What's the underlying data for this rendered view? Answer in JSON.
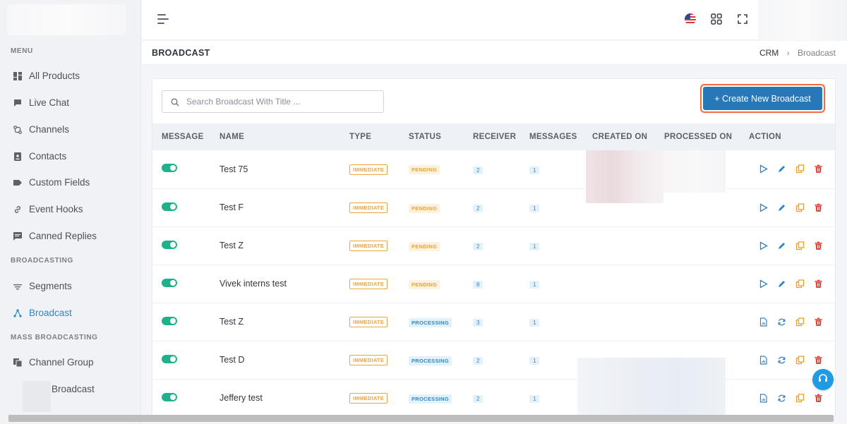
{
  "sidebar": {
    "menu_title": "MENU",
    "items": [
      {
        "label": "All Products",
        "icon": "grid-icon"
      },
      {
        "label": "Live Chat",
        "icon": "chat-icon"
      },
      {
        "label": "Channels",
        "icon": "channels-icon"
      },
      {
        "label": "Contacts",
        "icon": "contacts-icon"
      },
      {
        "label": "Custom Fields",
        "icon": "tag-icon"
      },
      {
        "label": "Event Hooks",
        "icon": "link-icon"
      },
      {
        "label": "Canned Replies",
        "icon": "message-icon"
      }
    ],
    "broadcasting_title": "BROADCASTING",
    "broadcasting_items": [
      {
        "label": "Segments",
        "icon": "segments-icon"
      },
      {
        "label": "Broadcast",
        "icon": "broadcast-icon",
        "active": true
      }
    ],
    "mass_title": "MASS BROADCASTING",
    "mass_items": [
      {
        "label": "Channel Group",
        "icon": "channel-group-icon"
      },
      {
        "label": "Broadcast"
      }
    ]
  },
  "page": {
    "title": "BROADCAST",
    "breadcrumb_root": "CRM",
    "breadcrumb_sep": "›",
    "breadcrumb_current": "Broadcast"
  },
  "search": {
    "placeholder": "Search Broadcast With Title ..."
  },
  "create_button": "+ Create New Broadcast",
  "table": {
    "headers": [
      "MESSAGE",
      "NAME",
      "TYPE",
      "STATUS",
      "RECEIVER",
      "MESSAGES",
      "CREATED ON",
      "PROCESSED ON",
      "ACTION"
    ],
    "rows": [
      {
        "name": "Test 75",
        "type": "IMMEDIATE",
        "status": "PENDING",
        "receiver": "2",
        "messages": "1"
      },
      {
        "name": "Test F",
        "type": "IMMEDIATE",
        "status": "PENDING",
        "receiver": "2",
        "messages": "1"
      },
      {
        "name": "Test Z",
        "type": "IMMEDIATE",
        "status": "PENDING",
        "receiver": "2",
        "messages": "1"
      },
      {
        "name": "Vivek interns test",
        "type": "IMMEDIATE",
        "status": "PENDING",
        "receiver": "8",
        "messages": "1"
      },
      {
        "name": "Test Z",
        "type": "IMMEDIATE",
        "status": "PROCESSING",
        "receiver": "3",
        "messages": "1"
      },
      {
        "name": "Test D",
        "type": "IMMEDIATE",
        "status": "PROCESSING",
        "receiver": "2",
        "messages": "1"
      },
      {
        "name": "Jeffery test",
        "type": "IMMEDIATE",
        "status": "PROCESSING",
        "receiver": "2",
        "messages": "1"
      }
    ]
  },
  "colors": {
    "accent": "#2d86c6",
    "toggle_on": "#1fb28a",
    "button": "#2878b8",
    "highlight": "#f26a3d",
    "pending": "#e8a33a",
    "delete": "#e0463d",
    "copy": "#f0a020"
  }
}
